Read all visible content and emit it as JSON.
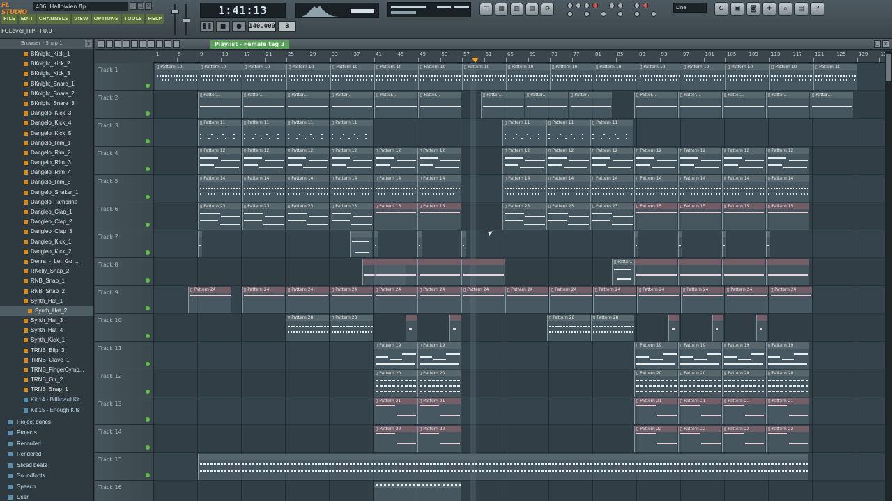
{
  "app": {
    "logo": "FL STUDIO",
    "file_name": "406. Hallowien.flp",
    "window_buttons": [
      "_",
      "□",
      "×"
    ],
    "menu": [
      "FILE",
      "EDIT",
      "CHANNELS",
      "VIEW",
      "OPTIONS",
      "TOOLS",
      "HELP"
    ],
    "hint_text": "FGLevel_ITP: +0.0"
  },
  "transport": {
    "time_display": "1:41:13",
    "tempo": "140.000",
    "pattern_number": "3",
    "snap_mode": "Line",
    "buttons": [
      "pause",
      "stop",
      "record"
    ]
  },
  "browser": {
    "title": "Browser - Snap 1",
    "items": [
      "BKnight_Kick_1",
      "BKnight_Kick_2",
      "BKnight_Kick_3",
      "BKnight_Snare_1",
      "BKnight_Snare_2",
      "BKnight_Snare_3",
      "Dangelo_Kick_3",
      "Dangelo_Kick_4",
      "Dangelo_Kick_5",
      "Dangelo_Rim_1",
      "Dangelo_Rim_2",
      "Dangelo_RIm_3",
      "Dangelo_RIm_4",
      "Dangelo_Rim_5",
      "Dangelo_Shaker_1",
      "Dangelo_Tambrine",
      "Dangleo_Clap_1",
      "Dangleo_Clap_2",
      "Dangleo_Clap_3",
      "Dangleo_Kick_1",
      "Dangleo_Kick_2",
      "Denra_-_Let_Go_...",
      "RKelly_Snap_2",
      "RNB_Snap_1",
      "RNB_Snap_2",
      "Synth_Hat_1",
      "Synth_Hat_2",
      "Synth_Hat_3",
      "Synth_Hat_4",
      "Synth_Kick_1",
      "TRNB_Blip_3",
      "TRNB_Clave_1",
      "TRNB_FingerCymb...",
      "TRNB_Gtr_2",
      "TRNB_Snap_1"
    ],
    "selected_item": "Synth_Hat_2",
    "kits": [
      "Kit 14 - Billboard Kit",
      "Kit 15 - Enough Kits"
    ],
    "folders": [
      "Project bones",
      "Projects",
      "Recorded",
      "Rendered",
      "Sliced beats",
      "Soundfonts",
      "Speech",
      "User"
    ]
  },
  "playlist": {
    "title": "Playlist - Female tag 3",
    "ruler_numbers": [
      "1",
      "5",
      "9",
      "13",
      "17",
      "21",
      "25",
      "29",
      "33",
      "37",
      "41",
      "45",
      "49",
      "53",
      "57",
      "61",
      "65",
      "69",
      "73",
      "77",
      "81",
      "85",
      "89",
      "93",
      "97",
      "101",
      "105",
      "109",
      "113",
      "117",
      "121",
      "125",
      "129",
      "133"
    ],
    "tracks": [
      "Track 1",
      "Track 2",
      "Track 3",
      "Track 4",
      "Track 5",
      "Track 6",
      "Track 7",
      "Track 8",
      "Track 9",
      "Track 10",
      "Track 11",
      "Track 12",
      "Track 13",
      "Track 14",
      "Track 15",
      "Track 16"
    ],
    "clip_labels": {
      "t1": "Pattern 10",
      "t2": "Patter...",
      "t3": "Pattern 11",
      "t4": "Pattern 12",
      "t5": "Pattern 14",
      "t6a": "Pattern 23",
      "t6b": "Pattern 15",
      "t8": "Patter...",
      "t9": "Pattern 24",
      "t10": "Pattern 28",
      "t11": "Pattern 19",
      "t12": "Pattern 20",
      "t13": "Pattern 21",
      "t14": "Pattern 22"
    }
  },
  "colors": {
    "accent_orange": "#f08a1c",
    "playlist_tab_green": "#59a05a",
    "track_led": "#62c045"
  }
}
